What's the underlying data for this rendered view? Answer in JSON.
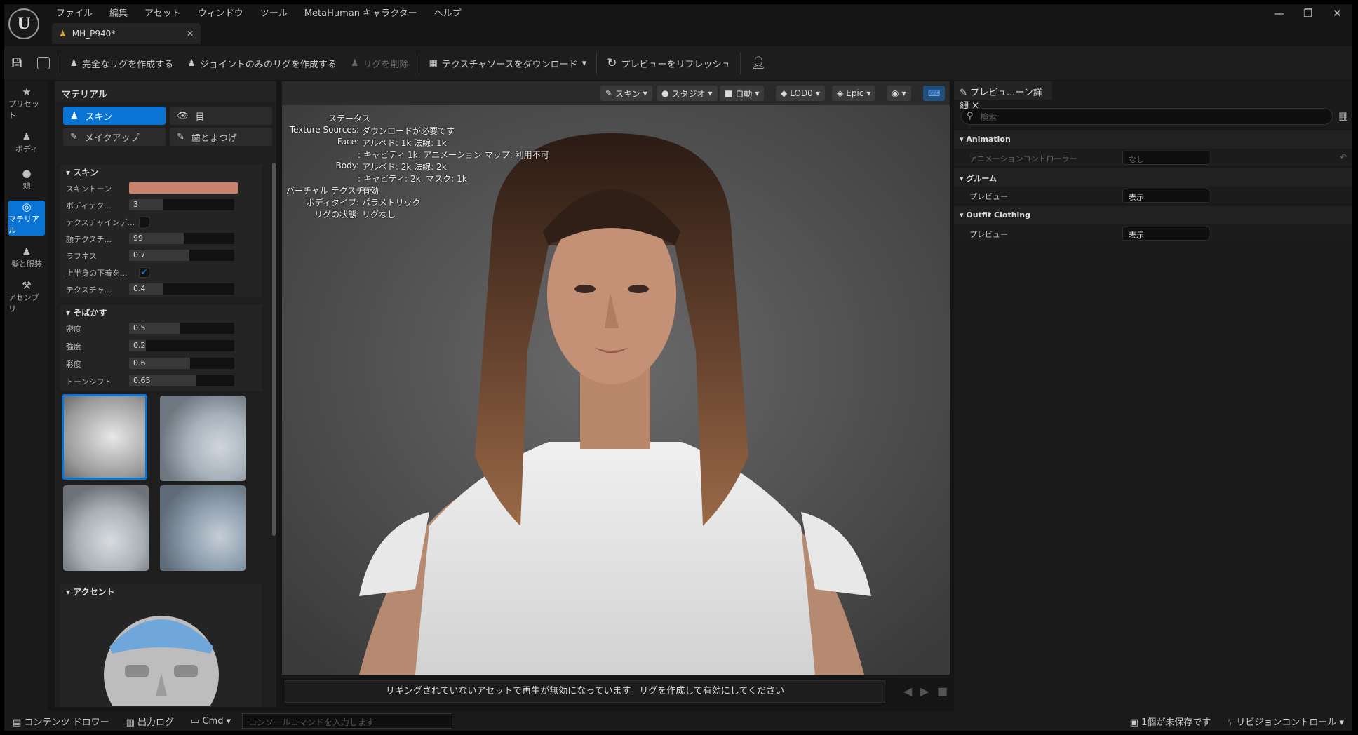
{
  "app": {
    "logo": "U",
    "menu": [
      "ファイル",
      "編集",
      "アセット",
      "ウィンドウ",
      "ツール",
      "MetaHuman キャラクター",
      "ヘルプ"
    ],
    "tab_title": "MH_P940*"
  },
  "toolbar": {
    "full_rig": "完全なリグを作成する",
    "joint_rig": "ジョイントのみのリグを作成する",
    "remove_rig": "リグを削除",
    "download_tex": "テクスチャソースをダウンロード",
    "refresh": "プレビューをリフレッシュ"
  },
  "leftnav": [
    {
      "label": "プリセット",
      "icon": "★"
    },
    {
      "label": "ボディ",
      "icon": "♟"
    },
    {
      "label": "頭",
      "icon": "●"
    },
    {
      "label": "マテリアル",
      "icon": "◎"
    },
    {
      "label": "髪と服装",
      "icon": "♟"
    },
    {
      "label": "アセンブリ",
      "icon": "⚒"
    }
  ],
  "panel": {
    "title": "マテリアル",
    "tabs": [
      "スキン",
      "目",
      "メイクアップ",
      "歯とまつげ"
    ],
    "skin": {
      "header": "スキン",
      "skin_tone": "スキントーン",
      "body_tex": "ボディテク...",
      "body_tex_v": "3",
      "tex_index": "テクスチャインデ...",
      "face_tex": "顔テクスチ...",
      "face_tex_v": "99",
      "roughness": "ラフネス",
      "roughness_v": "0.7",
      "underwear": "上半身の下着を...",
      "texture": "テクスチャ...",
      "texture_v": "0.4"
    },
    "freckles": {
      "header": "そばかす",
      "density": "密度",
      "density_v": "0.5",
      "strength": "強度",
      "strength_v": "0.2",
      "saturation": "彩度",
      "saturation_v": "0.6",
      "tone": "トーンシフト",
      "tone_v": "0.65"
    },
    "accent": "アクセント"
  },
  "viewport": {
    "buttons": [
      "スキン",
      "スタジオ",
      "自動",
      "LOD0",
      "Epic"
    ],
    "status_title": "ステータス",
    "status": [
      {
        "k": "Texture Sources:",
        "v": "ダウンロードが必要です"
      },
      {
        "k": "Face:",
        "v": "アルベド: 1k 法線: 1k"
      },
      {
        "k": "",
        "v": ": キャビティ 1k: アニメーション マップ: 利用不可"
      },
      {
        "k": "Body:",
        "v": "アルベド: 2k 法線: 2k"
      },
      {
        "k": "",
        "v": ": キャビティ: 2k, マスク: 1k"
      },
      {
        "k": "バーチャル テクスチャ:",
        "v": "有効"
      },
      {
        "k": "ボディタイプ:",
        "v": "パラメトリック"
      },
      {
        "k": "リグの状態:",
        "v": "リグなし"
      }
    ],
    "message": "リギングされていないアセットで再生が無効になっています。リグを作成して有効にしてください"
  },
  "details": {
    "tab": "プレビュ...ーン詳細",
    "search_placeholder": "検索",
    "animation": "Animation",
    "anim_ctrl": "アニメーションコントローラー",
    "anim_val": "なし",
    "groom": "グルーム",
    "groom_prev": "プレビュー",
    "groom_val": "表示",
    "outfit": "Outfit Clothing",
    "outfit_prev": "プレビュー",
    "outfit_val": "表示"
  },
  "bottom": {
    "content": "コンテンツ ドロワー",
    "output": "出力ログ",
    "cmd": "Cmd",
    "console_placeholder": "コンソールコマンドを入力します",
    "unsaved": "1個が未保存です",
    "revision": "リビジョンコントロール"
  },
  "colors": {
    "accent": "#0a74d4",
    "skin_tone": "#c8826e"
  }
}
